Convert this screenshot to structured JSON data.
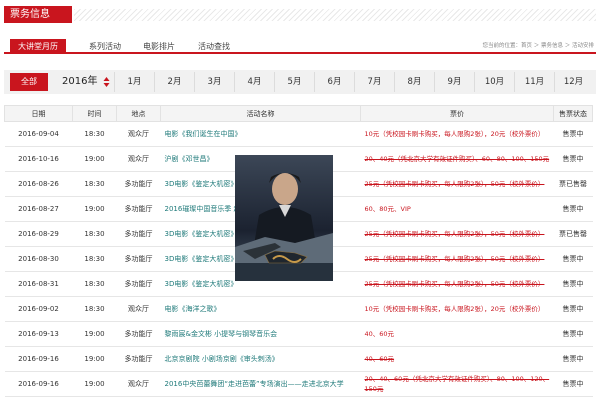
{
  "header": {
    "title": "票务信息"
  },
  "tabs": [
    {
      "label": "大讲堂月历",
      "active": true
    },
    {
      "label": "系列活动",
      "active": false
    },
    {
      "label": "电影排片",
      "active": false
    },
    {
      "label": "活动查找",
      "active": false
    }
  ],
  "breadcrumb": "您当前的位置：首页 ＞ 票务信息 ＞ 活动安排",
  "filter": {
    "all_label": "全部",
    "year": "2016年",
    "months": [
      "1月",
      "2月",
      "3月",
      "4月",
      "5月",
      "6月",
      "7月",
      "8月",
      "9月",
      "10月",
      "11月",
      "12月"
    ]
  },
  "table": {
    "headers": [
      "日期",
      "时间",
      "地点",
      "活动名称",
      "票价",
      "售票状态"
    ],
    "rows": [
      {
        "date": "2016-09-04",
        "time": "18:30",
        "venue": "观众厅",
        "name": "电影《我们诞生在中国》",
        "price": "10元（凭校园卡刷卡购买，每人限购2张），20元（校外票价）",
        "strike": false,
        "status": "售票中"
      },
      {
        "date": "2016-10-16",
        "time": "19:00",
        "venue": "观众厅",
        "name": "沪剧《邓世昌》",
        "price": "20、40元（凭北京大学有效证件购买）、60、80、100、150元",
        "strike": true,
        "status": "售票中"
      },
      {
        "date": "2016-08-26",
        "time": "18:30",
        "venue": "多功能厅",
        "name": "3D电影《鉴定大机密》",
        "price": "25元（凭校园卡刷卡购买，每人限购2张），50元（校外票价）",
        "strike": true,
        "status": "票已售罄"
      },
      {
        "date": "2016-08-27",
        "time": "19:00",
        "venue": "多功能厅",
        "name": "2016璀璨中国音乐季 超",
        "price": "60、80元、VIP",
        "strike": false,
        "status": "售票中"
      },
      {
        "date": "2016-08-29",
        "time": "18:30",
        "venue": "多功能厅",
        "name": "3D电影《鉴定大机密》",
        "price": "25元（凭校园卡刷卡购买，每人限购2张），50元（校外票价）",
        "strike": true,
        "status": "票已售罄"
      },
      {
        "date": "2016-08-30",
        "time": "18:30",
        "venue": "多功能厅",
        "name": "3D电影《鉴定大机密》",
        "price": "25元（凭校园卡刷卡购买，每人限购2张），50元（校外票价）",
        "strike": true,
        "status": "售票中"
      },
      {
        "date": "2016-08-31",
        "time": "18:30",
        "venue": "多功能厅",
        "name": "3D电影《鉴定大机密》",
        "price": "25元（凭校园卡刷卡购买，每人限购2张），50元（校外票价）",
        "strike": true,
        "status": "售票中"
      },
      {
        "date": "2016-09-02",
        "time": "18:30",
        "venue": "观众厅",
        "name": "电影《海洋之歌》",
        "price": "10元（凭校园卡刷卡购买，每人限购2张），20元（校外票价）",
        "strike": false,
        "status": "售票中"
      },
      {
        "date": "2016-09-13",
        "time": "19:00",
        "venue": "多功能厅",
        "name": "黎雨宸&金文彬 小提琴与钢琴音乐会",
        "price": "40、60元",
        "strike": false,
        "status": "售票中"
      },
      {
        "date": "2016-09-16",
        "time": "19:00",
        "venue": "多功能厅",
        "name": "北京京剧院 小剧场京剧《审头刺汤》",
        "price": "40、60元",
        "strike": true,
        "status": "售票中"
      },
      {
        "date": "2016-09-16",
        "time": "19:00",
        "venue": "观众厅",
        "name": "2016中央芭蕾舞团“走进芭蕾”专场演出——走进北京大学",
        "price": "20、40、60元（凭北京大学有效证件购买）、80、100、120、150元",
        "strike": true,
        "status": "售票中"
      }
    ]
  }
}
